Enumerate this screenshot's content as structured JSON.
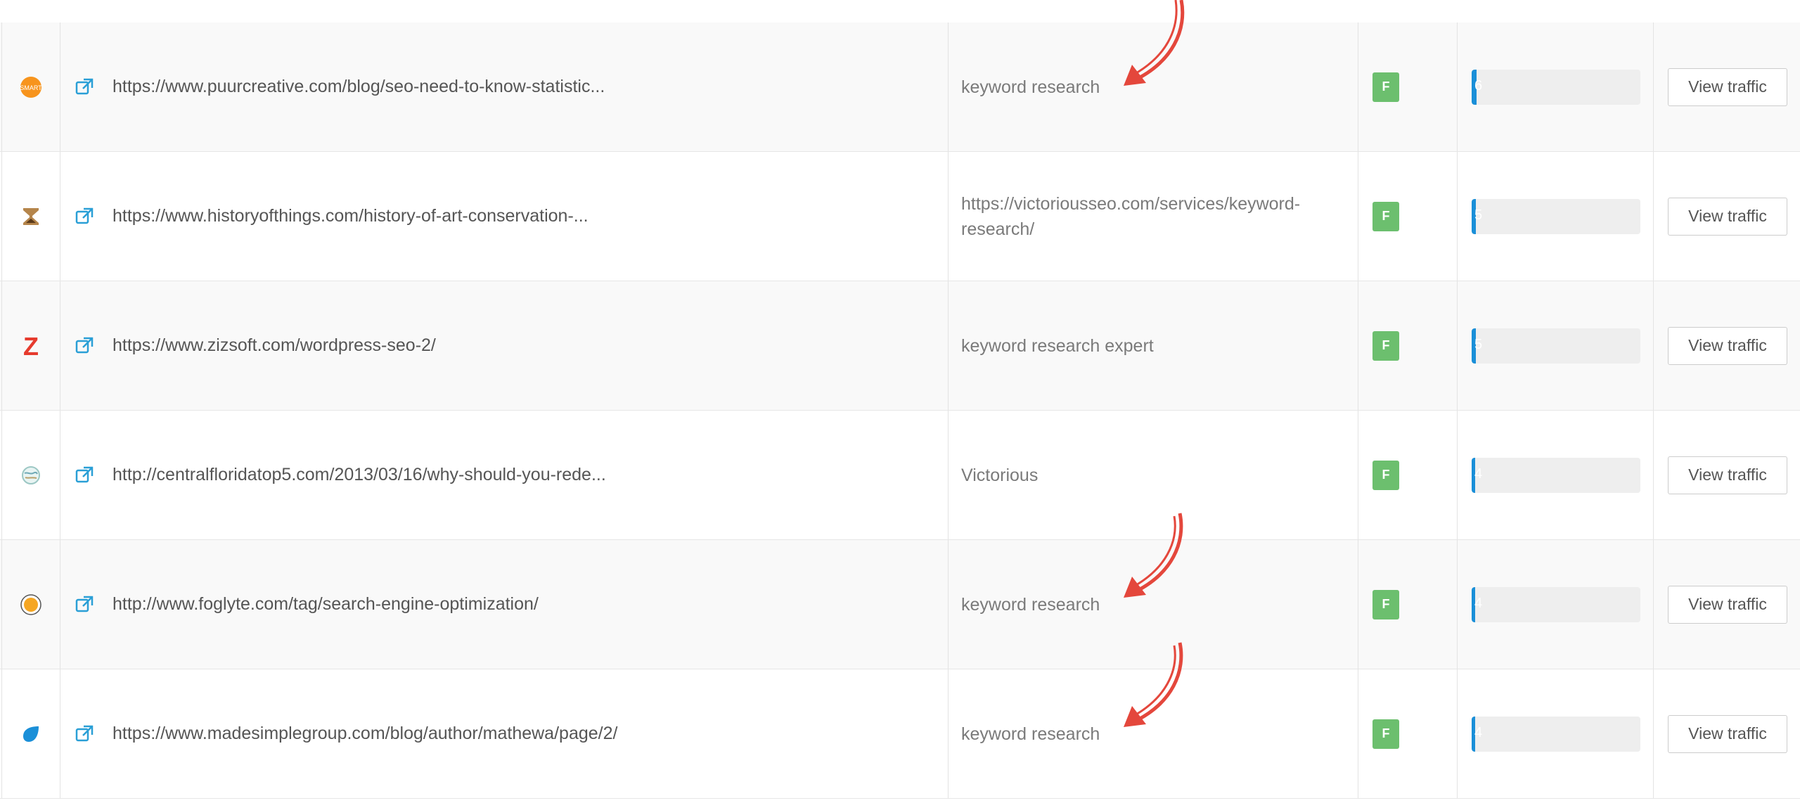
{
  "rows": [
    {
      "favicon_icon": "puurcreative-logo-icon",
      "favicon_text": "SMART",
      "url": "https://www.puurcreative.com/blog/seo-need-to-know-statistic...",
      "anchor": "keyword research",
      "badge": "F",
      "value": "6",
      "fill": 0.03,
      "button": "View traffic"
    },
    {
      "favicon_icon": "hourglass-icon",
      "url": "https://www.historyofthings.com/history-of-art-conservation-...",
      "anchor": "https://victoriousseo.com/services/keyword-research/",
      "badge": "F",
      "value": "5",
      "fill": 0.025,
      "button": "View traffic"
    },
    {
      "favicon_icon": "z-logo-icon",
      "favicon_text": "Z",
      "url": "https://www.zizsoft.com/wordpress-seo-2/",
      "anchor": "keyword research expert",
      "badge": "F",
      "value": "5",
      "fill": 0.025,
      "button": "View traffic"
    },
    {
      "favicon_icon": "globe-icon",
      "url": "http://centralfloridatop5.com/2013/03/16/why-should-you-rede...",
      "anchor": "Victorious",
      "badge": "F",
      "value": "4",
      "fill": 0.02,
      "button": "View traffic"
    },
    {
      "favicon_icon": "orange-circle-icon",
      "url": "http://www.foglyte.com/tag/search-engine-optimization/",
      "anchor": "keyword research",
      "badge": "F",
      "value": "4",
      "fill": 0.02,
      "button": "View traffic"
    },
    {
      "favicon_icon": "leaf-icon",
      "url": "https://www.madesimplegroup.com/blog/author/mathewa/page/2/",
      "anchor": "keyword research",
      "badge": "F",
      "value": "4",
      "fill": 0.02,
      "button": "View traffic"
    }
  ],
  "colors": {
    "arrow": "#e4473c",
    "badge": "#6cbf6e",
    "bar_fill": "#1a8fd8",
    "link_icon": "#2a9fd6"
  }
}
